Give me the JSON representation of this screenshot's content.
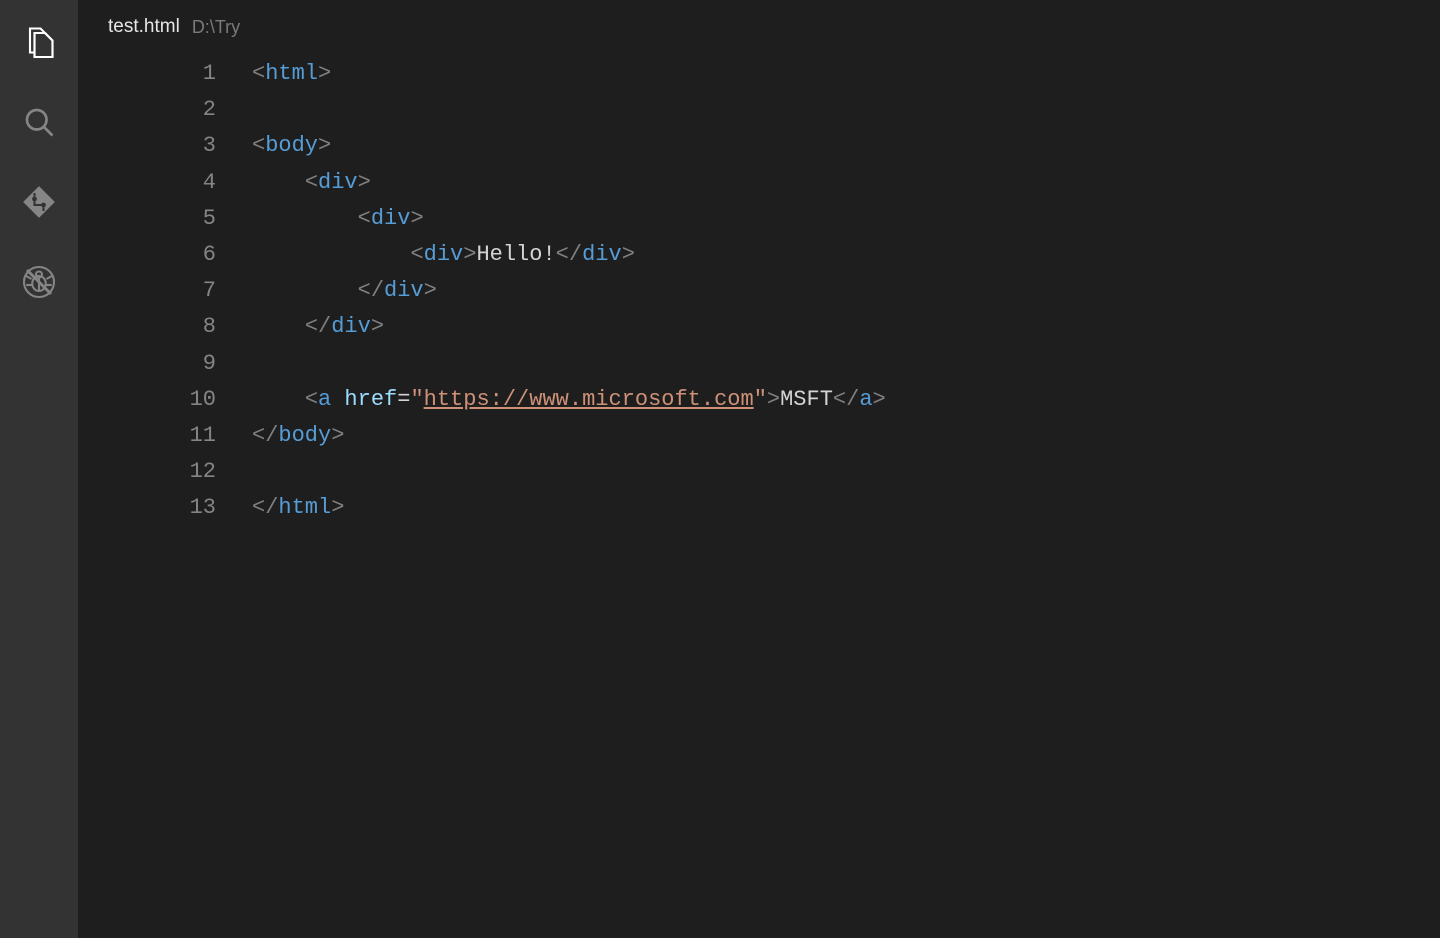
{
  "tab": {
    "filename": "test.html",
    "path": "D:\\Try"
  },
  "lineNumbers": [
    "1",
    "2",
    "3",
    "4",
    "5",
    "6",
    "7",
    "8",
    "9",
    "10",
    "11",
    "12",
    "13"
  ],
  "code": {
    "l1": {
      "indent": "",
      "open": "html"
    },
    "l2": {
      "blank": true
    },
    "l3": {
      "indent": "",
      "open": "body"
    },
    "l4": {
      "indent": "    ",
      "open": "div"
    },
    "l5": {
      "indent": "        ",
      "open": "div"
    },
    "l6": {
      "indent": "            ",
      "open": "div",
      "text": "Hello!",
      "close": "div"
    },
    "l7": {
      "indent": "        ",
      "close": "div"
    },
    "l8": {
      "indent": "    ",
      "close": "div"
    },
    "l9": {
      "blank": true
    },
    "l10": {
      "indent": "    ",
      "open": "a",
      "attr": "href",
      "url": "https://www.microsoft.com",
      "text": "MSFT",
      "close": "a"
    },
    "l11": {
      "indent": "",
      "close": "body"
    },
    "l12": {
      "blank": true
    },
    "l13": {
      "indent": "",
      "close": "html"
    }
  }
}
